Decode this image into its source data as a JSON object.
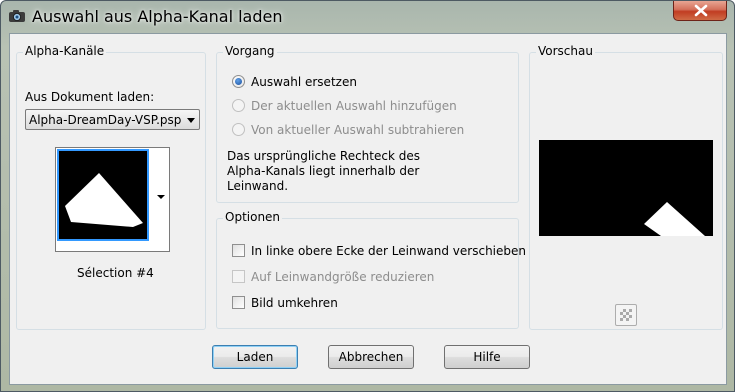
{
  "window": {
    "title": "Auswahl aus Alpha-Kanal laden"
  },
  "alpha": {
    "legend": "Alpha-Kanäle",
    "doc_label": "Aus Dokument laden:",
    "doc_value": "Alpha-DreamDay-VSP.psp",
    "selection_name": "Sélection #4"
  },
  "vorgang": {
    "legend": "Vorgang",
    "options": [
      {
        "label": "Auswahl ersetzen",
        "checked": true,
        "enabled": true
      },
      {
        "label": "Der aktuellen Auswahl hinzufügen",
        "checked": false,
        "enabled": false
      },
      {
        "label": "Von aktueller Auswahl subtrahieren",
        "checked": false,
        "enabled": false
      }
    ],
    "info_lines": [
      "Das ursprüngliche Rechteck des",
      "Alpha-Kanals liegt innerhalb der",
      "Leinwand."
    ]
  },
  "optionen": {
    "legend": "Optionen",
    "items": [
      {
        "label": "In linke obere Ecke der Leinwand verschieben",
        "checked": false,
        "enabled": true
      },
      {
        "label": "Auf Leinwandgröße reduzieren",
        "checked": false,
        "enabled": false
      },
      {
        "label": "Bild umkehren",
        "checked": false,
        "enabled": true
      }
    ]
  },
  "vorschau": {
    "legend": "Vorschau"
  },
  "buttons": {
    "load": "Laden",
    "cancel": "Abbrechen",
    "help": "Hilfe"
  },
  "colors": {
    "accent": "#3399ff",
    "close": "#c13c22",
    "disabled_text": "#8d8d8d"
  },
  "icons": {
    "app": "camera-icon",
    "close": "close-icon",
    "preview_toggle": "checkerboard-icon",
    "dropdown": "chevron-down-icon"
  }
}
